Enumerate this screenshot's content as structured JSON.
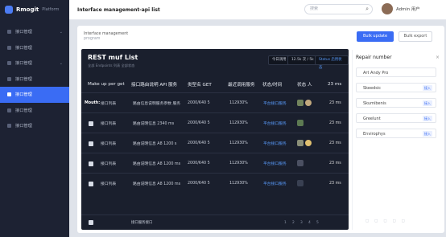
{
  "app": {
    "logo": "Rmogit",
    "logo_sub": "Platform"
  },
  "sidebar": {
    "items": [
      {
        "label": "接口管理",
        "active": false
      },
      {
        "label": "接口管理",
        "active": false
      },
      {
        "label": "接口管理",
        "active": false
      },
      {
        "label": "接口管理",
        "active": false
      },
      {
        "label": "接口管理",
        "active": true
      },
      {
        "label": "接口管理",
        "active": false
      },
      {
        "label": "接口管理",
        "active": false
      }
    ]
  },
  "topbar": {
    "title": "Interface management-api list",
    "search_placeholder": "搜索",
    "user": "Admin 用户"
  },
  "content": {
    "breadcrumb": "Interface management",
    "breadcrumb_sub": "program",
    "primary_button": "Bulk update",
    "secondary_button": "Bulk export"
  },
  "panel": {
    "title": "REST muf List",
    "subtitle": "全部 Endpoints 列表 全部状态",
    "chips": [
      "今日调用",
      "12.5k 次 / 5k",
      "Status 启用状态"
    ],
    "headers": [
      "Make up per get",
      "接口路由说明 API 服务",
      "类型名 GET",
      "最近调用服务",
      "状态/时间",
      "状态 人",
      "23 ms"
    ],
    "rows": [
      {
        "check": "Mouth:",
        "name": "接口列表",
        "desc": "路由信息说明服务参数 服务",
        "code": "2000/K40 5",
        "calls": "112930%",
        "link": "平台接口服务",
        "ms": "23 ms"
      },
      {
        "check": "",
        "name": "接口列表",
        "desc": "路由说明信息 2340 ms",
        "code": "2000/K40 5",
        "calls": "112930%",
        "link": "平台接口服务",
        "ms": "23 ms"
      },
      {
        "check": "",
        "name": "接口列表",
        "desc": "路由说明信息 A8 1200 s",
        "code": "2000/K40 5",
        "calls": "112930%",
        "link": "平台接口服务",
        "ms": "23 ms"
      },
      {
        "check": "",
        "name": "接口列表",
        "desc": "路由说明信息 A8 1200 ms",
        "code": "2000/K40 5",
        "calls": "112930%",
        "link": "平台接口服务",
        "ms": "23 ms"
      },
      {
        "check": "",
        "name": "接口列表",
        "desc": "路由说明信息 A8 1200 ms",
        "code": "2000/K40 5",
        "calls": "112930%",
        "link": "平台接口服务",
        "ms": "23 ms"
      }
    ],
    "footer": "接口服务接口",
    "pagination": [
      "1",
      "2",
      "3",
      "4",
      "5"
    ]
  },
  "repair": {
    "title": "Repair number",
    "items": [
      {
        "label": "Art Andy Pro",
        "badge": ""
      },
      {
        "label": "Skeedsic",
        "badge": "接入"
      },
      {
        "label": "Skumibenis",
        "badge": "接入"
      },
      {
        "label": "Greelunt",
        "badge": "接入"
      },
      {
        "label": "Envirophys",
        "badge": "接入"
      }
    ]
  }
}
